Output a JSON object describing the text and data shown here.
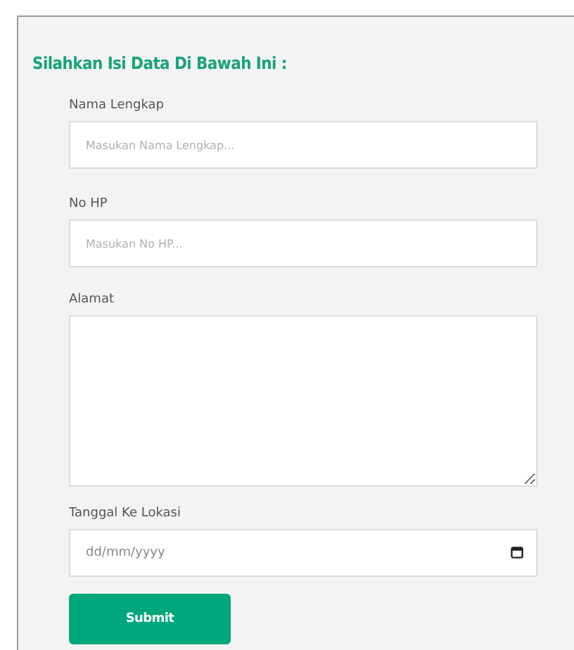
{
  "form": {
    "title": "Silahkan Isi Data Di Bawah Ini :",
    "fields": [
      {
        "kind": "text",
        "label": "Nama Lengkap",
        "placeholder": "Masukan Nama Lengkap..."
      },
      {
        "kind": "text",
        "label": "No HP",
        "placeholder": "Masukan No HP..."
      },
      {
        "kind": "textarea",
        "label": "Alamat"
      },
      {
        "kind": "date",
        "label": "Tanggal Ke Lokasi",
        "placeholder": "dd/mm/yyyy"
      }
    ],
    "submit": "Submit"
  }
}
